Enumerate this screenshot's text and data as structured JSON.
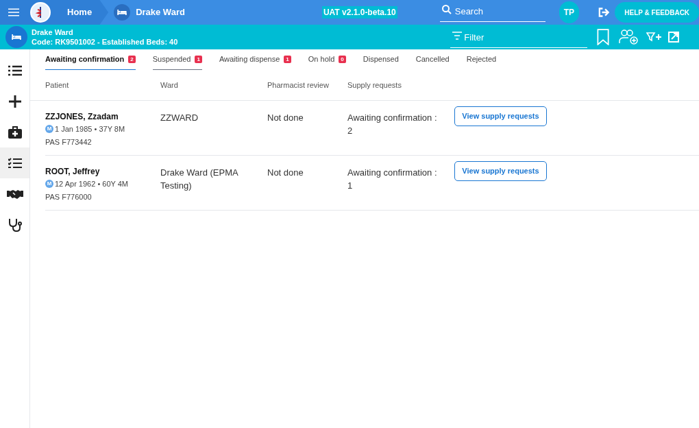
{
  "top_bar": {
    "breadcrumbs": [
      {
        "label": "Home",
        "kind": "home"
      },
      {
        "label": "Drake Ward",
        "kind": "ward"
      }
    ],
    "environment": "UAT v2.1.0-beta.10",
    "search": {
      "placeholder": "Search"
    },
    "user_initials": "TP",
    "help_button": "HELP & FEEDBACK"
  },
  "ward_bar": {
    "name": "Drake Ward",
    "details": "Code: RK9501002 - Established Beds: 40",
    "filter": {
      "placeholder": "Filter"
    }
  },
  "sidebar": {
    "items": [
      {
        "kind": "list",
        "selected": false
      },
      {
        "kind": "plus",
        "selected": false
      },
      {
        "kind": "medkit",
        "selected": false
      },
      {
        "kind": "checklist",
        "selected": true
      },
      {
        "kind": "handshake",
        "selected": false
      },
      {
        "kind": "stethoscope",
        "selected": false
      }
    ]
  },
  "tabs": [
    {
      "label": "Awaiting confirmation",
      "count": "2",
      "selected": true,
      "hovered": false
    },
    {
      "label": "Suspended",
      "count": "1",
      "selected": false,
      "hovered": true
    },
    {
      "label": "Awaiting dispense",
      "count": "1",
      "selected": false,
      "hovered": false
    },
    {
      "label": "On hold",
      "count": "0",
      "selected": false,
      "hovered": false
    },
    {
      "label": "Dispensed",
      "selected": false,
      "hovered": false
    },
    {
      "label": "Cancelled",
      "selected": false,
      "hovered": false
    },
    {
      "label": "Rejected",
      "selected": false,
      "hovered": false
    }
  ],
  "table": {
    "columns": [
      "Patient",
      "Ward",
      "Pharmacist review",
      "Supply requests"
    ],
    "rows": [
      {
        "name": "ZZJONES, Zzadam",
        "gender": "M",
        "dob": "1 Jan 1985 • 37Y 8M",
        "pas": "PAS F773442",
        "ward": "ZZWARD",
        "review": "Not done",
        "supply": "Awaiting confirmation : 2",
        "action": "View supply requests"
      },
      {
        "name": "ROOT, Jeffrey",
        "gender": "M",
        "dob": "12 Apr 1962 • 60Y 4M",
        "pas": "PAS F776000",
        "ward": "Drake Ward (EPMA Testing)",
        "review": "Not done",
        "supply": "Awaiting confirmation : 1",
        "action": "View supply requests"
      }
    ]
  }
}
